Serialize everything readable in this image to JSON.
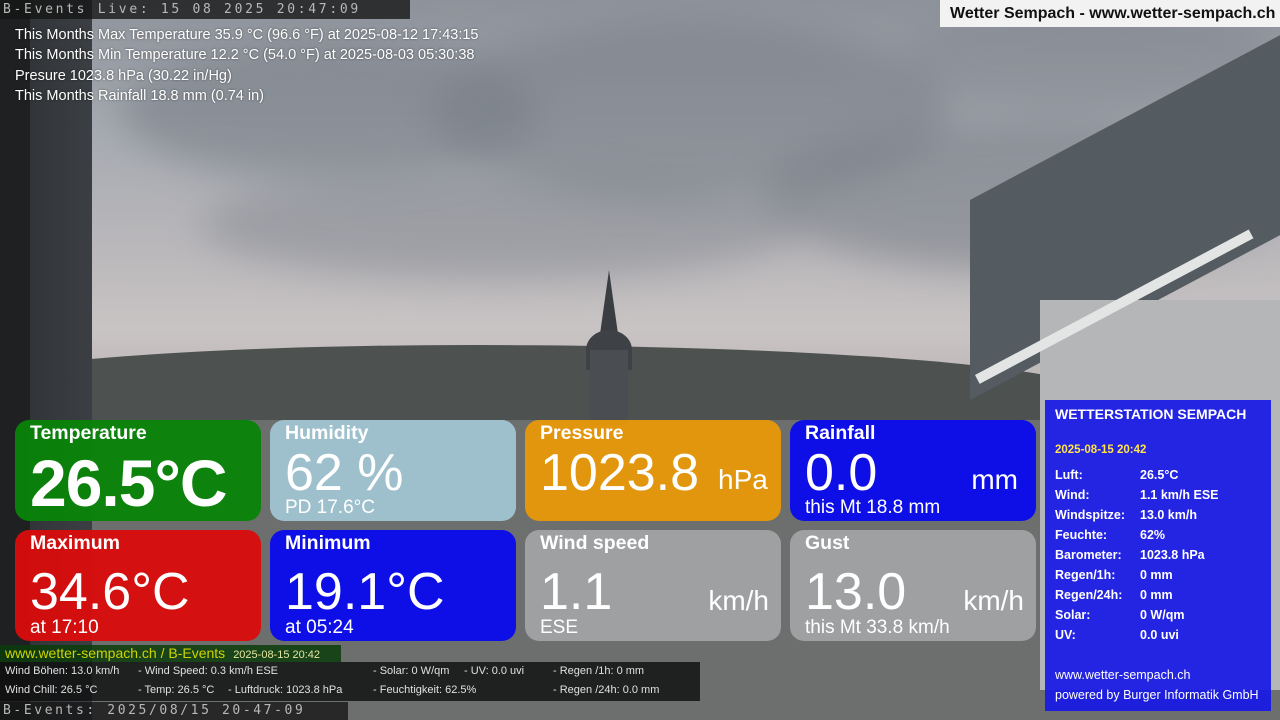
{
  "overlay": {
    "top_timestamp": "B-Events Live: 15 08 2025 20:47:09",
    "bottom_timestamp": "B-Events: 2025/08/15 20-47-09",
    "site_badge": "Wetter Sempach - www.wetter-sempach.ch"
  },
  "month_stats": [
    "This Months Max Temperature 35.9 °C (96.6 °F) at 2025-08-12 17:43:15",
    "This Months Min Temperature 12.2 °C (54.0 °F) at 2025-08-03 05:30:38",
    "Presure 1023.8 hPa (30.22 in/Hg)",
    "This Months Rainfall 18.8 mm (0.74 in)"
  ],
  "tiles": {
    "temperature": {
      "label": "Temperature",
      "value": "26.5°C",
      "color": "#088408"
    },
    "humidity": {
      "label": "Humidity",
      "value": "62 %",
      "sub": "PD 17.6°C",
      "color": "#aad2e1"
    },
    "pressure": {
      "label": "Pressure",
      "value": "1023.8",
      "unit": "hPa",
      "color": "#e89808"
    },
    "rainfall": {
      "label": "Rainfall",
      "value": "0.0",
      "unit": "mm",
      "sub": "this Mt 18.8 mm",
      "color": "#0a0aee"
    },
    "maximum": {
      "label": "Maximum",
      "value": "34.6°C",
      "sub": "at 17:10",
      "color": "#da0c0c"
    },
    "minimum": {
      "label": "Minimum",
      "value": "19.1°C",
      "sub": "at 05:24",
      "color": "#0a0aee"
    },
    "wind_speed": {
      "label": "Wind speed",
      "value": "1.1",
      "unit": "km/h",
      "sub": "ESE",
      "color": "#a8a8aa"
    },
    "gust": {
      "label": "Gust",
      "value": "13.0",
      "unit": "km/h",
      "sub": "this Mt 33.8 km/h",
      "color": "#a8a8aa"
    }
  },
  "station_panel": {
    "title": "WETTERSTATION SEMPACH",
    "date": "2025-08-15 20:42",
    "rows": [
      {
        "key": "Luft:",
        "value": "26.5°C"
      },
      {
        "key": "Wind:",
        "value": "1.1 km/h  ESE"
      },
      {
        "key": "Windspitze:",
        "value": "13.0 km/h"
      },
      {
        "key": "Feuchte:",
        "value": "62%"
      },
      {
        "key": "Barometer:",
        "value": "1023.8 hPa"
      },
      {
        "key": "Regen/1h:",
        "value": "0 mm"
      },
      {
        "key": "Regen/24h:",
        "value": "0 mm"
      },
      {
        "key": "Solar:",
        "value": "0 W/qm"
      },
      {
        "key": "UV:",
        "value": "0.0 uvi"
      }
    ],
    "footer_site": "www.wetter-sempach.ch",
    "footer_credit": "powered by Burger Informatik GmbH",
    "color": "#1818e6"
  },
  "ticker": {
    "site": "www.wetter-sempach.ch / B-Events",
    "date": "2025-08-15 20:42",
    "items": [
      "Wind Böhen: 13.0 km/h",
      "- Wind Speed: 0.3 km/h ESE",
      "- Solar: 0 W/qm",
      "- UV: 0.0 uvi",
      "- Regen /1h:   0 mm",
      "Wind Chill: 26.5 °C",
      "- Temp: 26.5 °C",
      "- Luftdruck: 1023.8 hPa",
      "- Feuchtigkeit: 62.5%",
      "- Regen /24h: 0.0 mm"
    ]
  }
}
